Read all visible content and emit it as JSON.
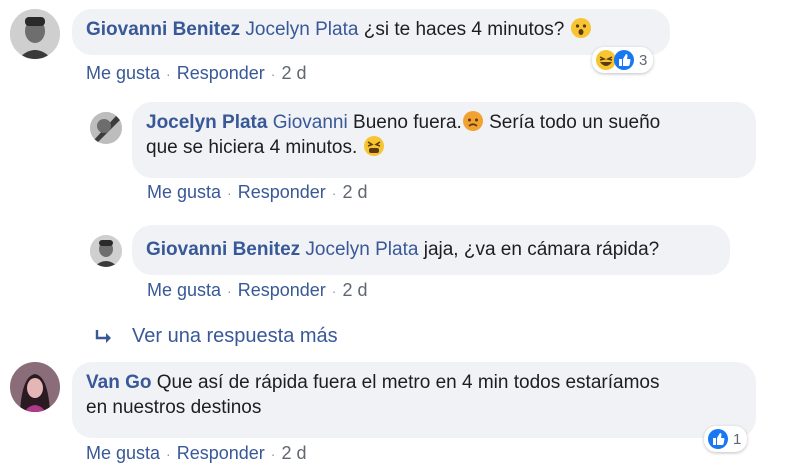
{
  "comments": [
    {
      "author": "Giovanni Benitez",
      "mention": "Jocelyn Plata",
      "text": "¿si te haces 4 minutos?",
      "emoji": "surprised-face-emoji",
      "like_label": "Me gusta",
      "reply_label": "Responder",
      "time": "2 d",
      "reactions": {
        "icons": [
          "laughing-face-emoji",
          "like-icon"
        ],
        "count": "3"
      }
    },
    {
      "author": "Jocelyn Plata",
      "mention": "Giovanni",
      "text_line1": "Bueno fuera.",
      "emoji1": "frowning-face-emoji",
      "text_line1b": " Sería todo un sueño",
      "text_line2": "que se hiciera 4 minutos.",
      "emoji2": "tired-face-emoji",
      "like_label": "Me gusta",
      "reply_label": "Responder",
      "time": "2 d"
    },
    {
      "author": "Giovanni Benitez",
      "mention": "Jocelyn Plata",
      "text": "jaja, ¿va en cámara rápida?",
      "like_label": "Me gusta",
      "reply_label": "Responder",
      "time": "2 d"
    },
    {
      "author": "Van Go",
      "text_line1": "Que así de rápida fuera el metro en 4 min todos estaríamos",
      "text_line2": "en nuestros destinos",
      "like_label": "Me gusta",
      "reply_label": "Responder",
      "time": "2 d",
      "reactions": {
        "icons": [
          "like-icon"
        ],
        "count": "1"
      }
    }
  ],
  "more_replies_label": "Ver una respuesta más",
  "colors": {
    "link": "#385898",
    "bubble": "#f0f2f5",
    "meta": "#606770"
  }
}
